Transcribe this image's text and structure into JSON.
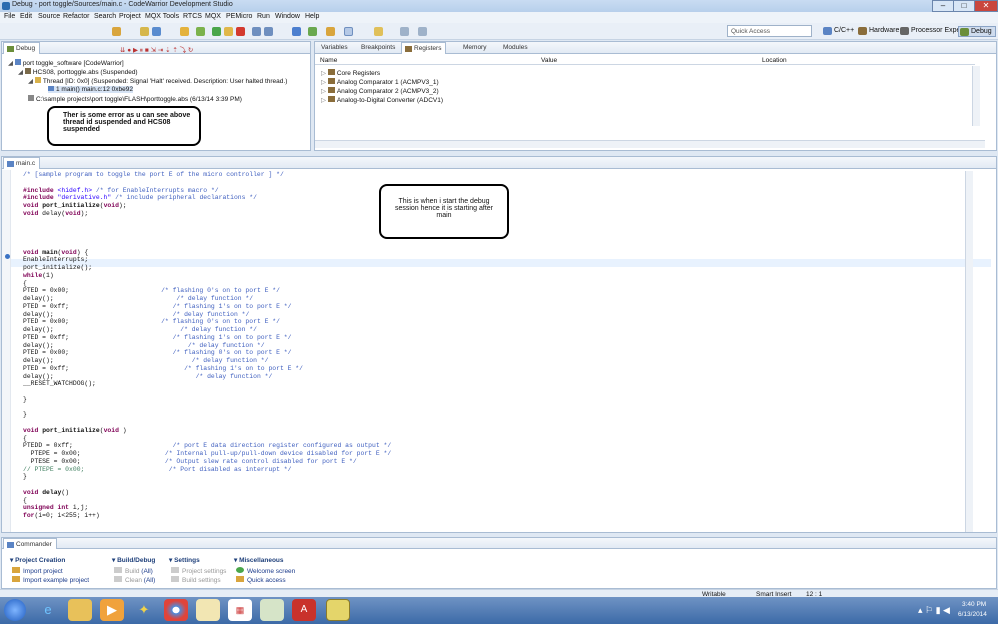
{
  "window": {
    "title": "Debug - port toggle/Sources/main.c - CodeWarrior Development Studio",
    "min": "–",
    "max": "□",
    "close": "✕"
  },
  "menu": [
    "File",
    "Edit",
    "Source",
    "Refactor",
    "Search",
    "Project",
    "MQX Tools",
    "RTCS",
    "MQX",
    "PEMicro",
    "Run",
    "Window",
    "Help"
  ],
  "toolbar": {
    "quick_access": "Quick Access"
  },
  "perspectives": [
    "C/C++",
    "Hardware",
    "Processor Expert",
    "Debug"
  ],
  "debug_view": {
    "tab": "Debug",
    "items": [
      "port toggle_software [CodeWarrior]",
      "HCS08, porttoggle.abs (Suspended)",
      "Thread [ID: 0x0] (Suspended: Signal 'Halt' received. Description: User halted thread.)",
      "1 main() main.c:12 0xbe92",
      "C:\\sample projects\\port toggle\\FLASH\\porttoggle.abs (6/13/14 3:39 PM)"
    ]
  },
  "registers_view": {
    "tabs": [
      "Variables",
      "Breakpoints",
      "Registers",
      "Memory",
      "Modules"
    ],
    "columns": [
      "Name",
      "Value",
      "Location"
    ],
    "rows": [
      "Core Registers",
      "Analog Comparator 1 (ACMPV3_1)",
      "Analog Comparator 2 (ACMPV3_2)",
      "Analog-to-Digital Converter (ADCV1)"
    ]
  },
  "editor": {
    "tab": "main.c"
  },
  "callouts": {
    "error": "Ther is some error as u can see above thread id suspended and HCS08 suspended",
    "start": "This is when i start the debug session hence it is starting after main"
  },
  "commander": {
    "tab": "Commander",
    "project_creation": {
      "title": "Project Creation",
      "items": [
        "Import project",
        "Import example project"
      ]
    },
    "build_debug": {
      "title": "Build/Debug",
      "items": [
        "Build",
        "Clean"
      ],
      "suffix": "(All)"
    },
    "settings": {
      "title": "Settings",
      "items": [
        "Project settings",
        "Build settings"
      ]
    },
    "misc": {
      "title": "Miscellaneous",
      "items": [
        "Welcome screen",
        "Quick access"
      ]
    }
  },
  "status": {
    "writable": "Writable",
    "insert": "Smart Insert",
    "pos": "12 : 1"
  },
  "clock": {
    "time": "3:40 PM",
    "date": "6/13/2014"
  }
}
